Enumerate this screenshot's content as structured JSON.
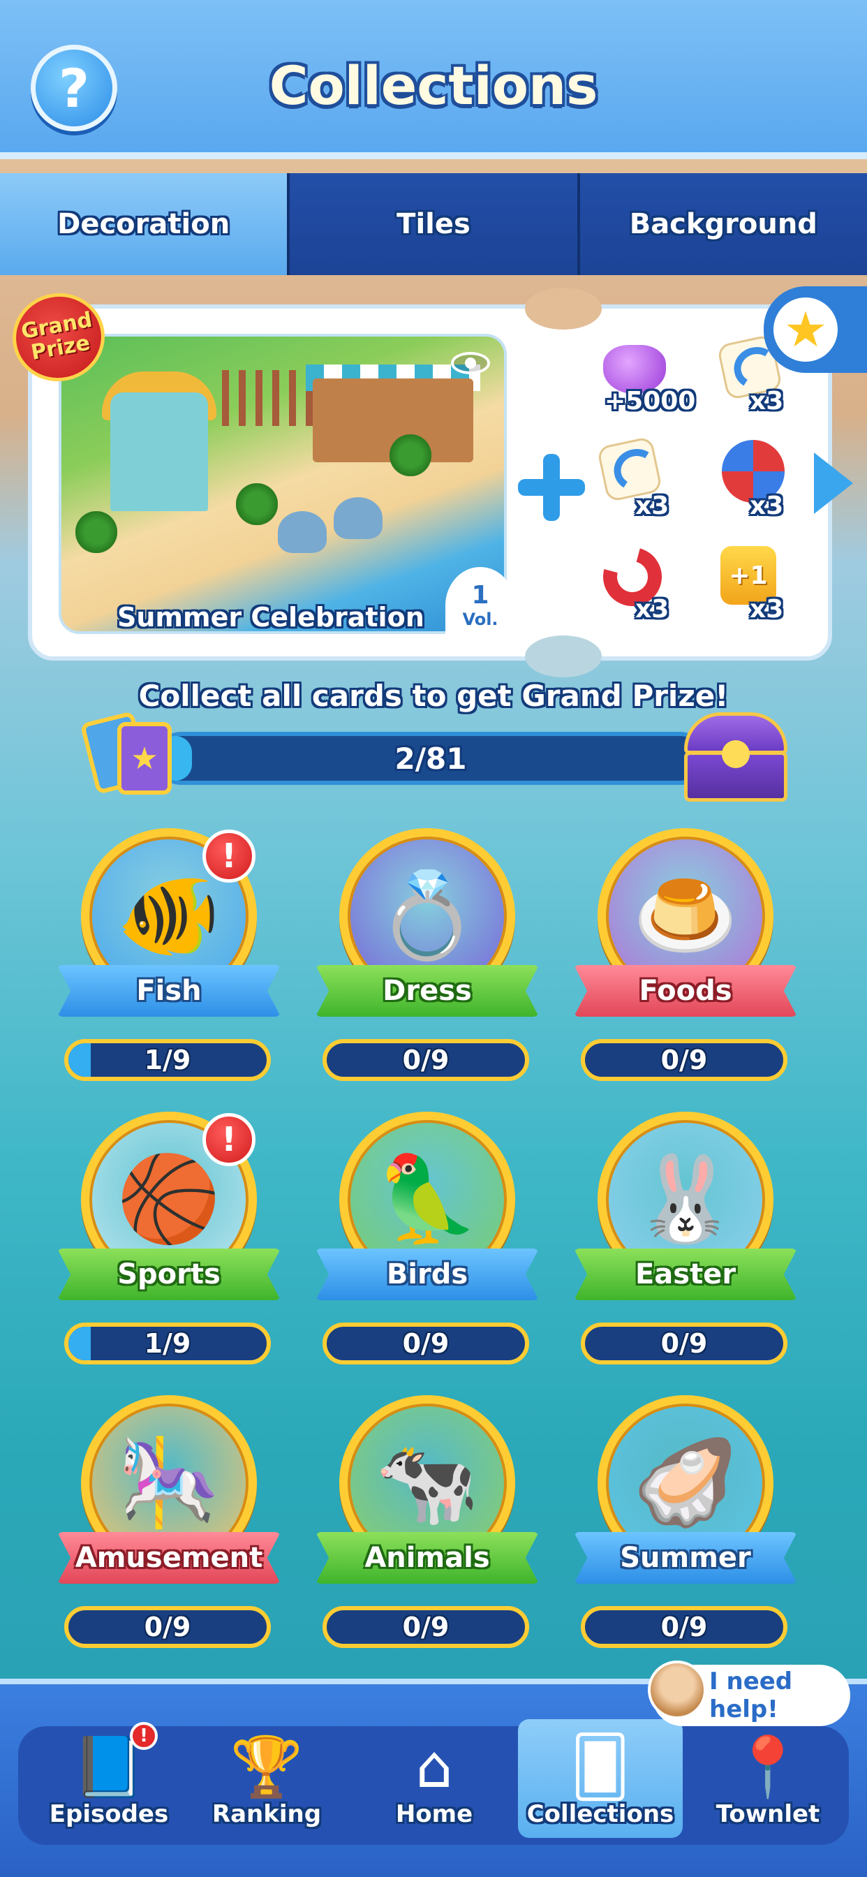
{
  "header": {
    "title": "Collections",
    "help_label": "?"
  },
  "tabs": [
    {
      "label": "Decoration",
      "active": true
    },
    {
      "label": "Tiles",
      "active": false
    },
    {
      "label": "Background",
      "active": false
    }
  ],
  "grand_prize": {
    "badge_line1": "Grand",
    "badge_line2": "Prize",
    "scene_name": "Summer Celebration",
    "vol_number": "1",
    "vol_label": "Vol.",
    "rewards": [
      {
        "icon": "gem-icon",
        "count": "+5000"
      },
      {
        "icon": "undo-icon",
        "count": "x3"
      },
      {
        "icon": "undo-icon",
        "count": "x3"
      },
      {
        "icon": "pinwheel-icon",
        "count": "x3"
      },
      {
        "icon": "magnet-icon",
        "count": "x3"
      },
      {
        "icon": "plus-one-icon",
        "badge": "+1",
        "count": "x3"
      }
    ]
  },
  "progress": {
    "message": "Collect all cards to get Grand Prize!",
    "text": "2/81",
    "fraction": 0.0247
  },
  "collections": [
    {
      "label": "Fish",
      "progress": "1/9",
      "fraction": 0.111,
      "ribbon": "blue",
      "art": "🐠",
      "medal_bg": "#4aa6f0",
      "alert": "!"
    },
    {
      "label": "Dress",
      "progress": "0/9",
      "fraction": 0,
      "ribbon": "green",
      "art": "💍",
      "medal_bg": "#7a5dd8"
    },
    {
      "label": "Foods",
      "progress": "0/9",
      "fraction": 0,
      "ribbon": "red",
      "art": "🍮",
      "medal_bg": "#b86bd8"
    },
    {
      "label": "Sports",
      "progress": "1/9",
      "fraction": 0.111,
      "ribbon": "green",
      "art": "🏀",
      "medal_bg": "#bfe8f2",
      "alert": "!"
    },
    {
      "label": "Birds",
      "progress": "0/9",
      "fraction": 0,
      "ribbon": "blue",
      "art": "🦜",
      "medal_bg": "#7ccf6a"
    },
    {
      "label": "Easter",
      "progress": "0/9",
      "fraction": 0,
      "ribbon": "green",
      "art": "🐰",
      "medal_bg": "#8fd2f0"
    },
    {
      "label": "Amusement",
      "progress": "0/9",
      "fraction": 0,
      "ribbon": "red",
      "art": "🎠",
      "medal_bg": "#f6c66a"
    },
    {
      "label": "Animals",
      "progress": "0/9",
      "fraction": 0,
      "ribbon": "green",
      "art": "🐄",
      "medal_bg": "#8fd066"
    },
    {
      "label": "Summer",
      "progress": "0/9",
      "fraction": 0,
      "ribbon": "blue",
      "art": "🦪",
      "medal_bg": "#5fc4e6"
    }
  ],
  "help_bubble": {
    "text": "I need help!"
  },
  "bottom_nav": [
    {
      "label": "Episodes",
      "icon": "book-icon",
      "glyph": "📘",
      "badge": "!"
    },
    {
      "label": "Ranking",
      "icon": "trophy-icon",
      "glyph": "🏆"
    },
    {
      "label": "Home",
      "icon": "home-icon",
      "glyph": "⌂"
    },
    {
      "label": "Collections",
      "icon": "cards-icon",
      "glyph": "🂠",
      "active": true
    },
    {
      "label": "Townlet",
      "icon": "map-pin-icon",
      "glyph": "📍"
    }
  ]
}
